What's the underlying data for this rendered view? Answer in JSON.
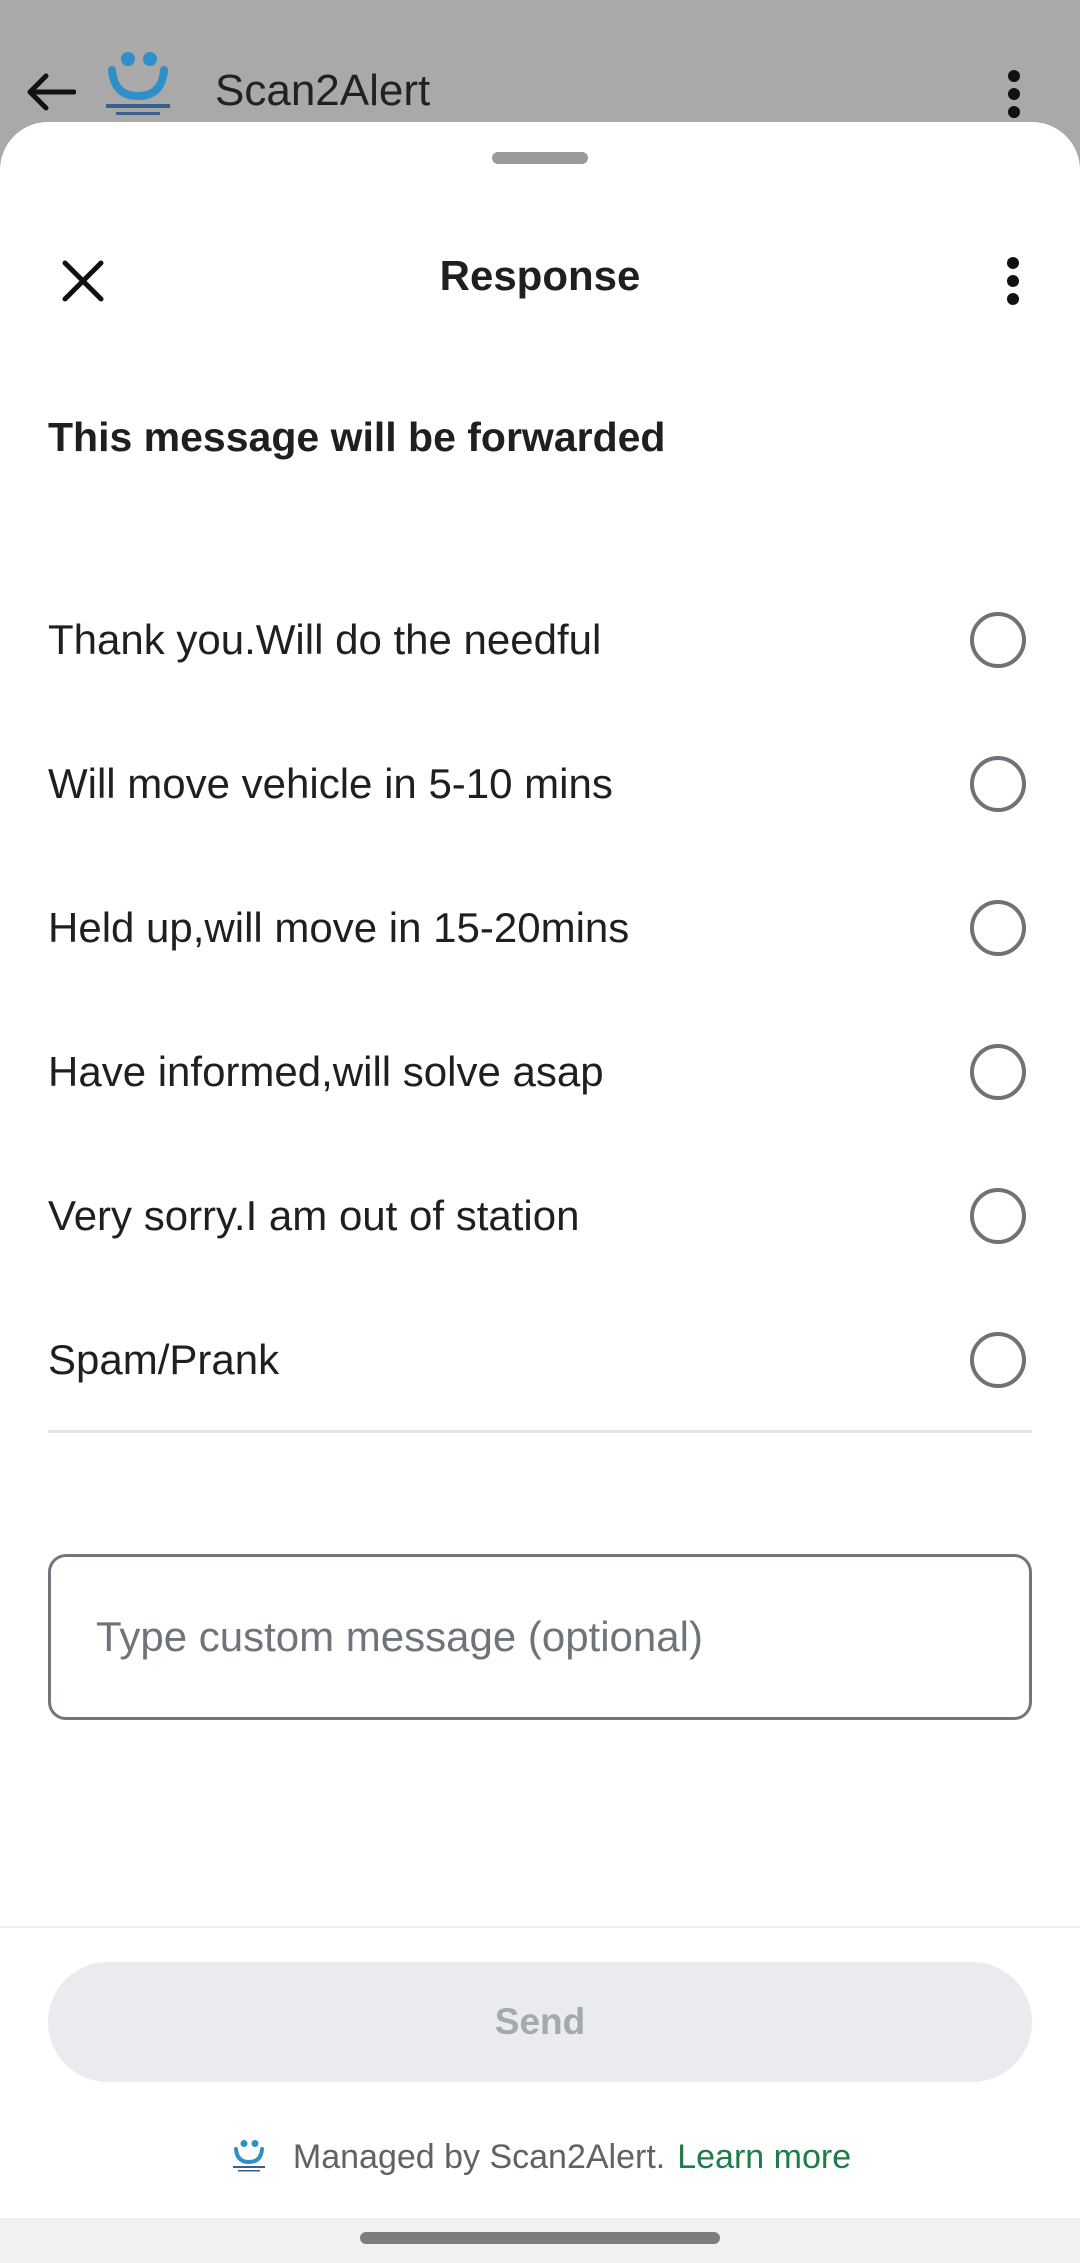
{
  "app_bar": {
    "title": "Scan2Alert",
    "back_icon": "arrow-left-icon",
    "menu_icon": "more-vert-icon",
    "logo_icon": "scan2alert-logo"
  },
  "sheet": {
    "title": "Response",
    "close_icon": "close-icon",
    "more_icon": "more-vert-icon",
    "heading": "This message will be forwarded",
    "options": [
      {
        "label": "Thank you.Will do the needful",
        "selected": false
      },
      {
        "label": "Will move vehicle in 5-10 mins",
        "selected": false
      },
      {
        "label": "Held up,will move in 15-20mins",
        "selected": false
      },
      {
        "label": "Have informed,will solve asap",
        "selected": false
      },
      {
        "label": "Very sorry.I am out of station",
        "selected": false
      },
      {
        "label": "Spam/Prank",
        "selected": false
      }
    ],
    "custom_message": {
      "value": "",
      "placeholder": "Type custom message (optional)"
    },
    "send_label": "Send",
    "footer": {
      "text": "Managed by Scan2Alert.",
      "link": "Learn more"
    }
  },
  "colors": {
    "scrim": "#a9a9a9",
    "accent_link": "#1e7d47",
    "send_disabled_bg": "#e9ebee",
    "send_disabled_text": "#a4a9ae",
    "logo_blue": "#2f8fc9"
  }
}
